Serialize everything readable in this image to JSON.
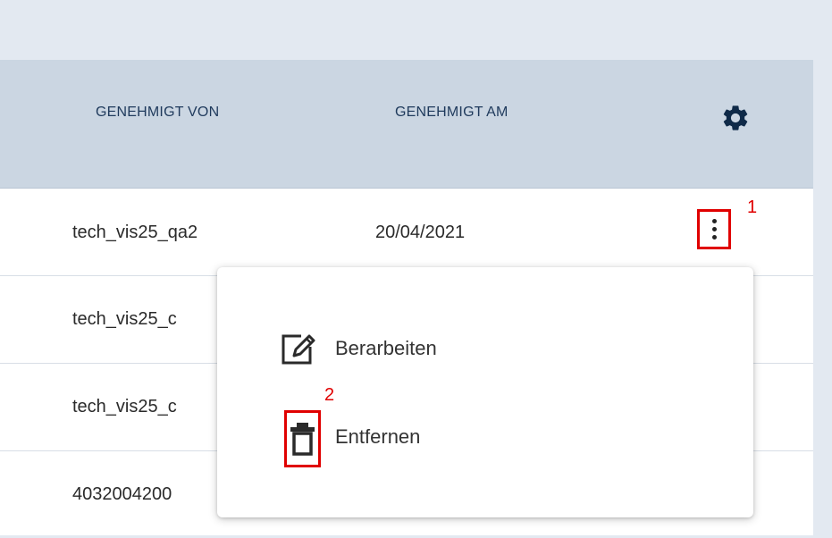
{
  "table": {
    "columns": {
      "approved_by": "GENEHMIGT VON",
      "approved_on": "GENEHMIGT AM"
    },
    "settings_icon": "gear-icon",
    "rows": [
      {
        "approved_by": "tech_vis25_qa2",
        "approved_on": "20/04/2021"
      },
      {
        "approved_by": "tech_vis25_c",
        "approved_on": ""
      },
      {
        "approved_by": "tech_vis25_c",
        "approved_on": ""
      },
      {
        "approved_by": "4032004200",
        "approved_on": ""
      }
    ]
  },
  "context_menu": {
    "edit_label": "Berarbeiten",
    "edit_icon": "edit-icon",
    "remove_label": "Entfernen",
    "remove_icon": "trash-icon"
  },
  "annotations": {
    "marker_1": "1",
    "marker_2": "2",
    "color": "#e00000"
  }
}
